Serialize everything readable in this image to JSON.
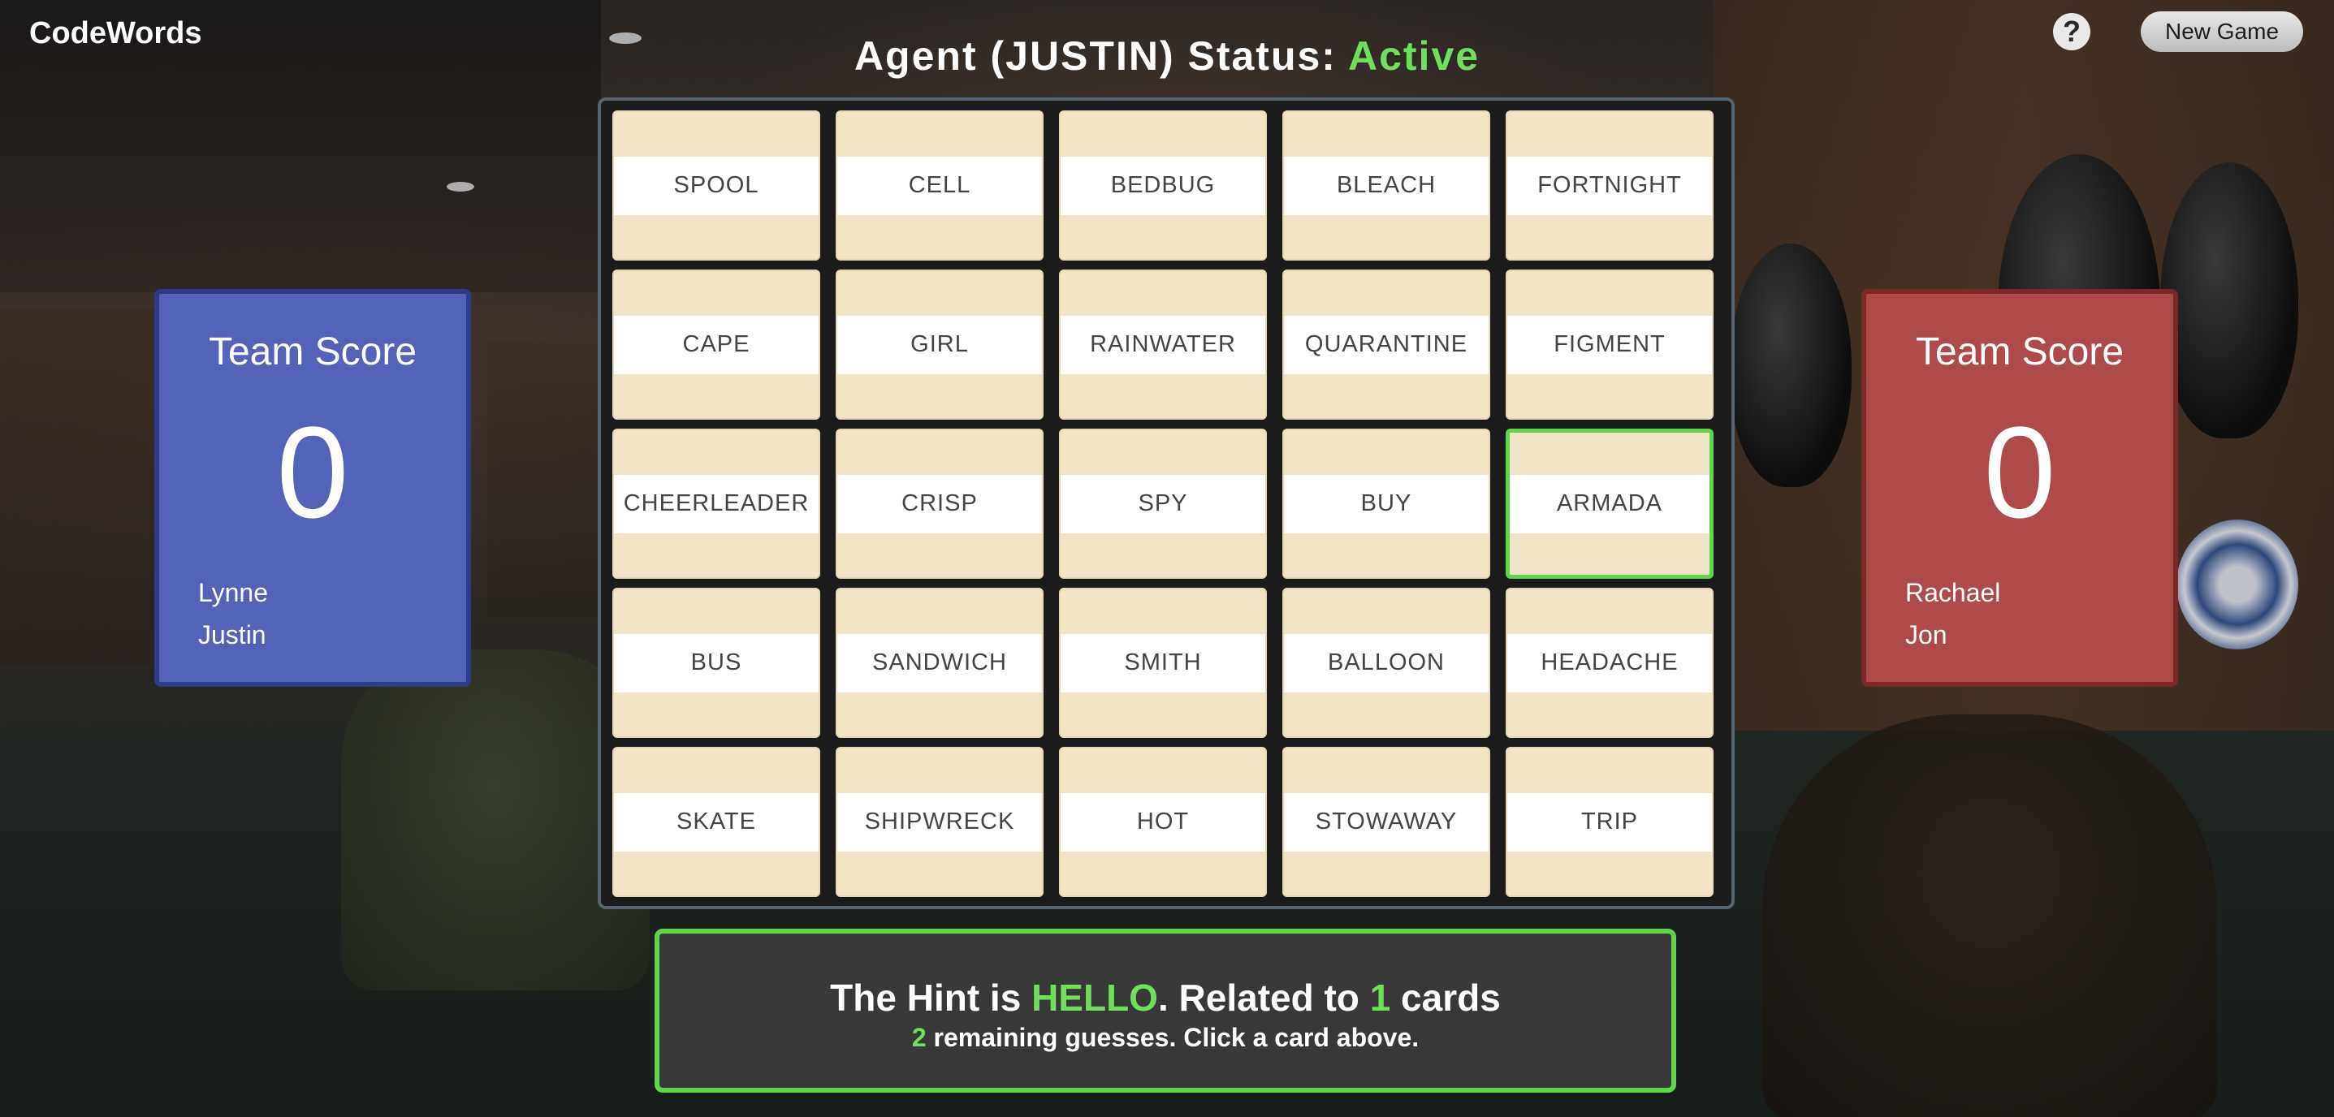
{
  "app": {
    "title": "CodeWords"
  },
  "header": {
    "status_prefix": "Agent (JUSTIN) Status: ",
    "status_value": "Active",
    "help_label": "?",
    "new_game_label": "New Game"
  },
  "board": {
    "cards": [
      "SPOOL",
      "CELL",
      "BEDBUG",
      "BLEACH",
      "FORTNIGHT",
      "CAPE",
      "GIRL",
      "RAINWATER",
      "QUARANTINE",
      "FIGMENT",
      "CHEERLEADER",
      "CRISP",
      "SPY",
      "BUY",
      "ARMADA",
      "BUS",
      "SANDWICH",
      "SMITH",
      "BALLOON",
      "HEADACHE",
      "SKATE",
      "SHIPWRECK",
      "HOT",
      "STOWAWAY",
      "TRIP"
    ],
    "selected": "ARMADA"
  },
  "teams": {
    "blue": {
      "title": "Team Score",
      "score": "0",
      "members": [
        "Lynne",
        "Justin"
      ],
      "color": "#5462b7"
    },
    "red": {
      "title": "Team Score",
      "score": "0",
      "members": [
        "Rachael",
        "Jon"
      ],
      "color": "#ae4a4a"
    }
  },
  "hint": {
    "prefix": "The Hint is ",
    "word": "HELLO",
    "middle": ". Related to ",
    "count": "1",
    "suffix": " cards",
    "guesses": "2",
    "guesses_suffix": " remaining guesses. Click a card above."
  },
  "colors": {
    "accent_green": "#6ee05a"
  }
}
